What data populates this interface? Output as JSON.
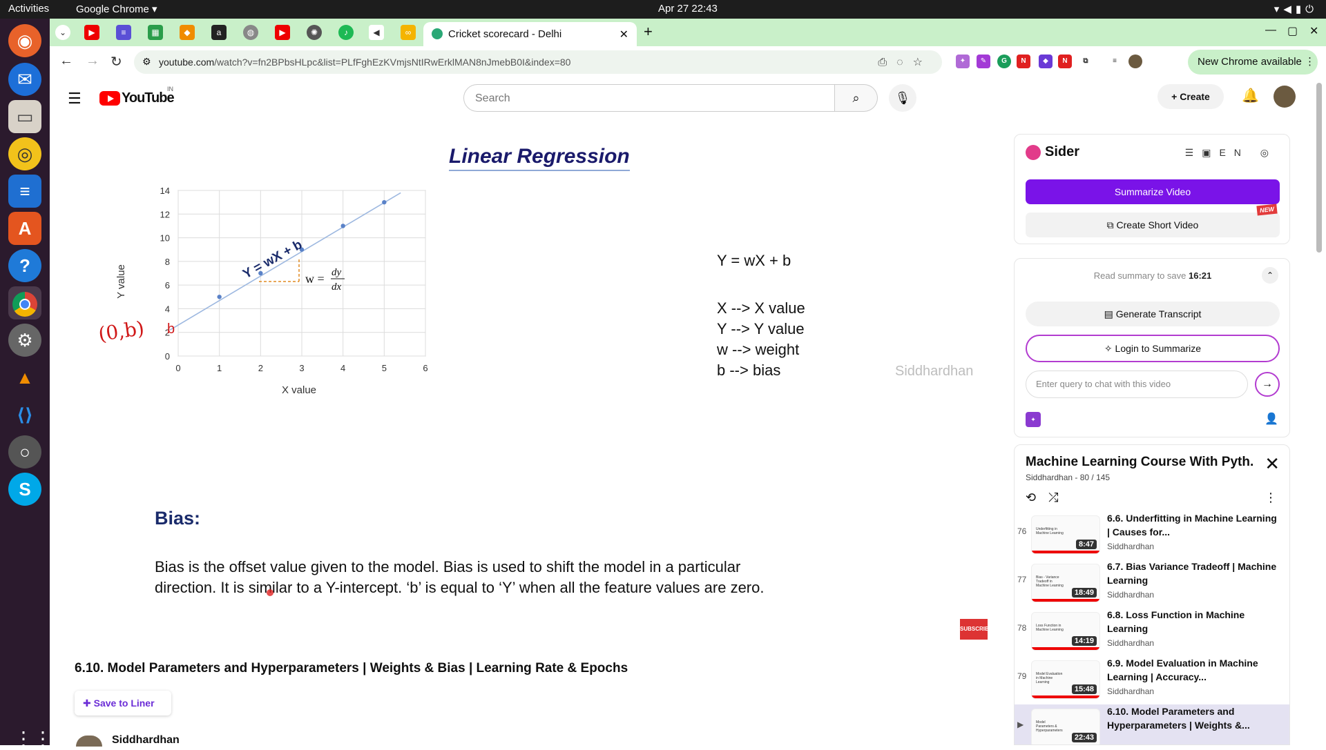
{
  "os": {
    "activities": "Activities",
    "app_name": "Google Chrome ▾",
    "clock": "Apr 27  22:43"
  },
  "browser": {
    "active_tab": "Cricket scorecard - Delhi",
    "url_host": "youtube.com",
    "url_path": "/watch?v=fn2BPbsHLpc&list=PLfFghEzKVmjsNtIRwErklMAN8nJmebB0I&index=80",
    "new_chrome": "New Chrome available"
  },
  "youtube": {
    "logo_word": "YouTube",
    "country_code": "IN",
    "search_placeholder": "Search",
    "create_label": "Create"
  },
  "slide": {
    "title": "Linear Regression",
    "equation": "Y = wX + b",
    "defs": [
      "X --> X value",
      "Y --> Y value",
      "w --> weight",
      "b  --> bias"
    ],
    "watermark": "Siddhardhan",
    "bias_heading": "Bias:",
    "bias_line1": "Bias is the offset value given to the model. Bias is used to shift the model in a particular",
    "bias_line2": "direction. It is similar to a Y-intercept. ‘b’ is equal to ‘Y’ when all the feature values are zero.",
    "line_label": "Y = wX + b",
    "slope_label": "w =",
    "slope_num": "dy",
    "slope_den": "dx",
    "b_label": "b",
    "hand_note": "(0,b)",
    "subscribe": "SUBSCRIBE"
  },
  "chart_data": {
    "type": "line",
    "xlabel": "X value",
    "ylabel": "Y value",
    "xlim": [
      0,
      6
    ],
    "ylim": [
      0,
      14
    ],
    "x_ticks": [
      "0",
      "1",
      "2",
      "3",
      "4",
      "5",
      "6"
    ],
    "y_ticks": [
      "0",
      "2",
      "4",
      "6",
      "8",
      "10",
      "12",
      "14"
    ],
    "grid": true,
    "series": [
      {
        "x": [
          0,
          5.4
        ],
        "y": [
          3,
          13.8
        ]
      },
      {
        "x": [
          1,
          2,
          3,
          4,
          5
        ],
        "y": [
          5,
          7,
          9,
          11,
          13
        ]
      }
    ]
  },
  "video": {
    "title": "6.10. Model Parameters and Hyperparameters | Weights & Bias | Learning Rate & Epochs",
    "save_liner": "Save to Liner",
    "channel": "Siddhardhan"
  },
  "sider": {
    "name": "Sider",
    "lang": "EN",
    "summarize": "Summarize Video",
    "short_video": "Create Short Video",
    "new_badge": "NEW",
    "read_summary": "Read summary to save",
    "read_time": "16:21",
    "transcript": "Generate Transcript",
    "login": "Login to Summarize",
    "query_placeholder": "Enter query to chat with this video"
  },
  "playlist": {
    "title": "Machine Learning Course With Pyth...",
    "subtitle": "Siddhardhan - 80 / 145",
    "items": [
      {
        "num": "76",
        "title": "6.6. Underfitting in Machine Learning | Causes for...",
        "channel": "Siddhardhan",
        "duration": "8:47",
        "thumb": "Underfitting in Machine Learning"
      },
      {
        "num": "77",
        "title": "6.7. Bias Variance Tradeoff | Machine Learning",
        "channel": "Siddhardhan",
        "duration": "18:49",
        "thumb": "Bias - Variance Tradeoff in Machine Learning"
      },
      {
        "num": "78",
        "title": "6.8. Loss Function in Machine Learning",
        "channel": "Siddhardhan",
        "duration": "14:19",
        "thumb": "Loss Function in Machine Learning"
      },
      {
        "num": "79",
        "title": "6.9. Model Evaluation in Machine Learning | Accuracy...",
        "channel": "Siddhardhan",
        "duration": "15:48",
        "thumb": "Model Evaluation in Machine Learning"
      },
      {
        "num": "▶",
        "title": "6.10. Model Parameters and Hyperparameters | Weights &...",
        "channel": "",
        "duration": "22:43",
        "thumb": "Model Parameters & Hyperparameters"
      }
    ]
  }
}
